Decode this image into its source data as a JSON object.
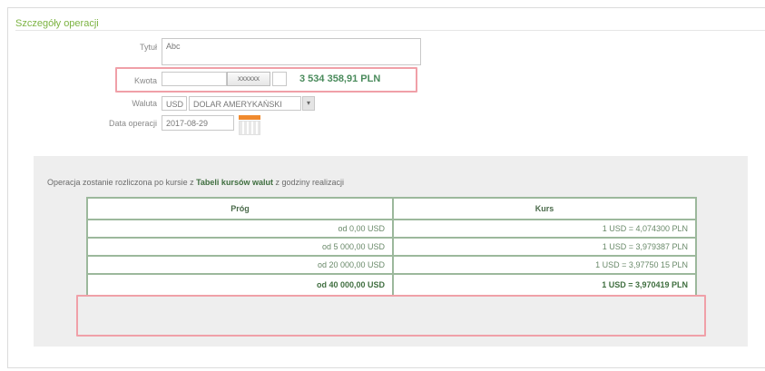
{
  "section": {
    "title": "Szczegóły operacji"
  },
  "form": {
    "tytul": {
      "label": "Tytuł",
      "value": "Abc"
    },
    "kwota": {
      "label": "Kwota",
      "value": "",
      "button_label": "xxxxxx",
      "suffix_value": "",
      "amount_pln": "3 534 358,91 PLN"
    },
    "waluta": {
      "label": "Waluta",
      "code": "USD",
      "name": "DOLAR AMERYKAŃSKI"
    },
    "data": {
      "label": "Data operacji",
      "value": "2017-08-29"
    }
  },
  "info": {
    "prefix": "Operacja zostanie rozliczona po kursie z ",
    "link": "Tabeli kursów walut",
    "suffix": " z godziny realizacji"
  },
  "rates_table": {
    "headers": [
      "Próg",
      "Kurs"
    ],
    "rows": [
      {
        "threshold": "od 0,00 USD",
        "rate": "1 USD = 4,074300 PLN"
      },
      {
        "threshold": "od 5 000,00 USD",
        "rate": "1 USD = 3,979387 PLN"
      },
      {
        "threshold": "od 20 000,00 USD",
        "rate": "1 USD = 3,97750 15 PLN"
      },
      {
        "threshold": "od 40 000,00 USD",
        "rate": "1 USD = 3,970419 PLN"
      }
    ]
  },
  "colors": {
    "accent": "#7cb342",
    "highlight": "#f0a0a8",
    "table_border": "#9cb89c",
    "calendar": "#f08a2e"
  },
  "icons": {
    "calendar": "calendar-icon",
    "select_arrow": "chevron-down-icon"
  }
}
